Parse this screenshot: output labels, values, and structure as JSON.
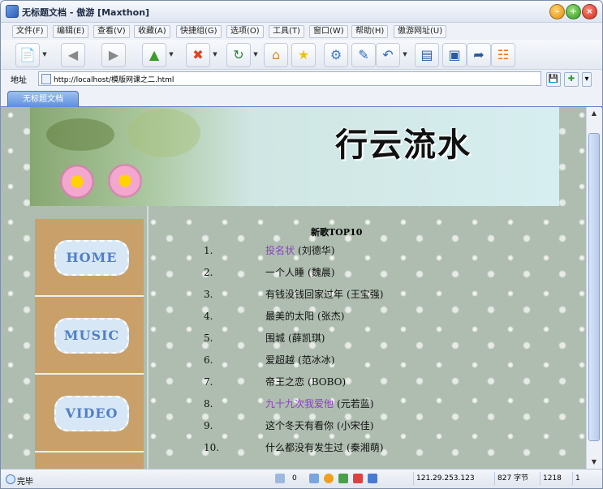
{
  "window": {
    "title": "无标题文档 - 傲游 [Maxthon]"
  },
  "menu": [
    "文件(F)",
    "编辑(E)",
    "查看(V)",
    "收藏(A)",
    "快捷组(G)",
    "选项(O)",
    "工具(T)",
    "窗口(W)",
    "帮助(H)",
    "傲游网址(U)"
  ],
  "address": {
    "label": "地址",
    "url": "http://localhost/模版网课之二.html"
  },
  "tabs": [
    {
      "label": "无标题文档"
    }
  ],
  "page": {
    "banner_title": "行云流水",
    "nav": [
      "HOME",
      "MUSIC",
      "VIDEO"
    ],
    "songs_title": "新歌TOP10",
    "songs": [
      {
        "num": "1.",
        "title": "投名状",
        "artist": "(刘德华)",
        "highlight": true
      },
      {
        "num": "2.",
        "title": "一个人睡",
        "artist": "(魏晨)",
        "highlight": false
      },
      {
        "num": "3.",
        "title": "有钱没钱回家过年",
        "artist": "(王宝强)",
        "highlight": false
      },
      {
        "num": "4.",
        "title": "最美的太阳",
        "artist": "(张杰)",
        "highlight": false
      },
      {
        "num": "5.",
        "title": "围城",
        "artist": "(薛凯琪)",
        "highlight": false
      },
      {
        "num": "6.",
        "title": "爱超越",
        "artist": "(范冰冰)",
        "highlight": false
      },
      {
        "num": "7.",
        "title": "帝王之恋",
        "artist": "(BOBO)",
        "highlight": false
      },
      {
        "num": "8.",
        "title": "九十九次我爱他",
        "artist": "(元若蓝)",
        "highlight": true
      },
      {
        "num": "9.",
        "title": "这个冬天有看你",
        "artist": "(小宋佳)",
        "highlight": false
      },
      {
        "num": "10.",
        "title": "什么都没有发生过",
        "artist": "(秦湘萌)",
        "highlight": false
      }
    ]
  },
  "status": {
    "text": "完毕",
    "count": "0",
    "ip": "121.29.253.123",
    "size": "827 字节",
    "time": "1218",
    "page": "1"
  },
  "icons": {
    "new": "new-page-icon",
    "back": "back-icon",
    "forward": "forward-icon",
    "up": "up-icon",
    "stop": "stop-icon",
    "refresh": "refresh-icon",
    "home": "home-icon",
    "favorites": "favorites-icon",
    "tools": "tools-icon",
    "edit": "edit-icon",
    "undo": "undo-icon",
    "split": "split-view-icon",
    "panel": "panel-icon",
    "export": "export-icon",
    "rss": "rss-icon"
  }
}
